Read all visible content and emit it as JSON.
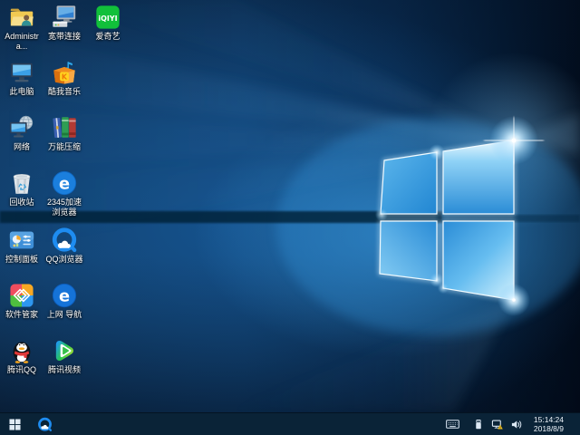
{
  "desktop": {
    "icons": [
      {
        "label": "Administra...",
        "icon": "user-folder-icon"
      },
      {
        "label": "宽带连接",
        "icon": "broadband-connection-icon"
      },
      {
        "label": "爱奇艺",
        "icon": "iqiyi-icon"
      },
      {
        "label": "此电脑",
        "icon": "this-pc-icon"
      },
      {
        "label": "酷我音乐",
        "icon": "kuwo-music-icon"
      },
      {
        "label": "网络",
        "icon": "network-icon"
      },
      {
        "label": "万能压缩",
        "icon": "archiver-icon"
      },
      {
        "label": "回收站",
        "icon": "recycle-bin-icon"
      },
      {
        "label": "2345加速浏览器",
        "icon": "2345-browser-icon"
      },
      {
        "label": "控制面板",
        "icon": "control-panel-icon"
      },
      {
        "label": "QQ浏览器",
        "icon": "qq-browser-icon"
      },
      {
        "label": "软件管家",
        "icon": "software-manager-icon"
      },
      {
        "label": "上网 导航",
        "icon": "web-navigation-icon"
      },
      {
        "label": "腾讯QQ",
        "icon": "tencent-qq-icon"
      },
      {
        "label": "腾讯视频",
        "icon": "tencent-video-icon"
      }
    ]
  },
  "taskbar": {
    "background_color": "#0a2337",
    "pinned": [
      {
        "name": "QQ浏览器",
        "icon": "qq-browser-icon"
      }
    ],
    "tray": {
      "icons": [
        "touch-keyboard-icon",
        "usb-device-icon",
        "network-warning-icon",
        "volume-icon"
      ],
      "clock": {
        "time": "15:14:24",
        "date": "2018/8/9"
      }
    }
  },
  "wallpaper": {
    "name": "windows-10-hero",
    "accent_color": "#2a8fd8"
  }
}
